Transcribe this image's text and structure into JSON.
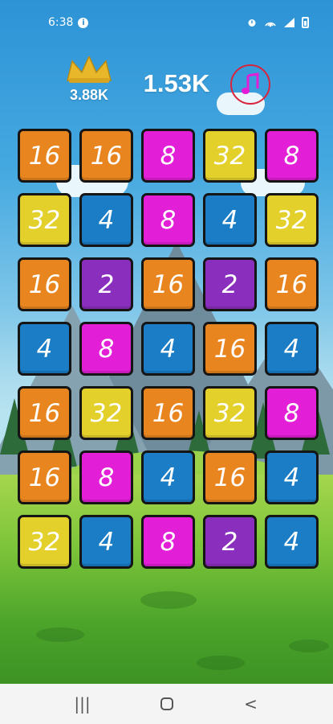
{
  "status_bar": {
    "time": "6:38",
    "info_icon": "i",
    "icons": [
      "alarm-icon",
      "hotspot-icon",
      "signal-icon",
      "battery-icon"
    ]
  },
  "header": {
    "best_score": "3.88K",
    "current_score": "1.53K",
    "music_icon": "music-note-icon"
  },
  "board": {
    "rows": [
      [
        "16",
        "16",
        "8",
        "32",
        "8"
      ],
      [
        "32",
        "4",
        "8",
        "4",
        "32"
      ],
      [
        "16",
        "2",
        "16",
        "2",
        "16"
      ],
      [
        "4",
        "8",
        "4",
        "16",
        "4"
      ],
      [
        "16",
        "32",
        "16",
        "32",
        "8"
      ],
      [
        "16",
        "8",
        "4",
        "16",
        "4"
      ],
      [
        "32",
        "4",
        "8",
        "2",
        "4"
      ]
    ]
  },
  "nav_bar": {
    "recent_label": "|||",
    "back_label": "<"
  },
  "colors": {
    "tile_2": "#8a2fbd",
    "tile_4": "#1a7dc5",
    "tile_8": "#e21fd6",
    "tile_16": "#e8851f",
    "tile_32": "#e3d02b",
    "crown": "#e8b82a",
    "music_accent": "#d8253d"
  }
}
